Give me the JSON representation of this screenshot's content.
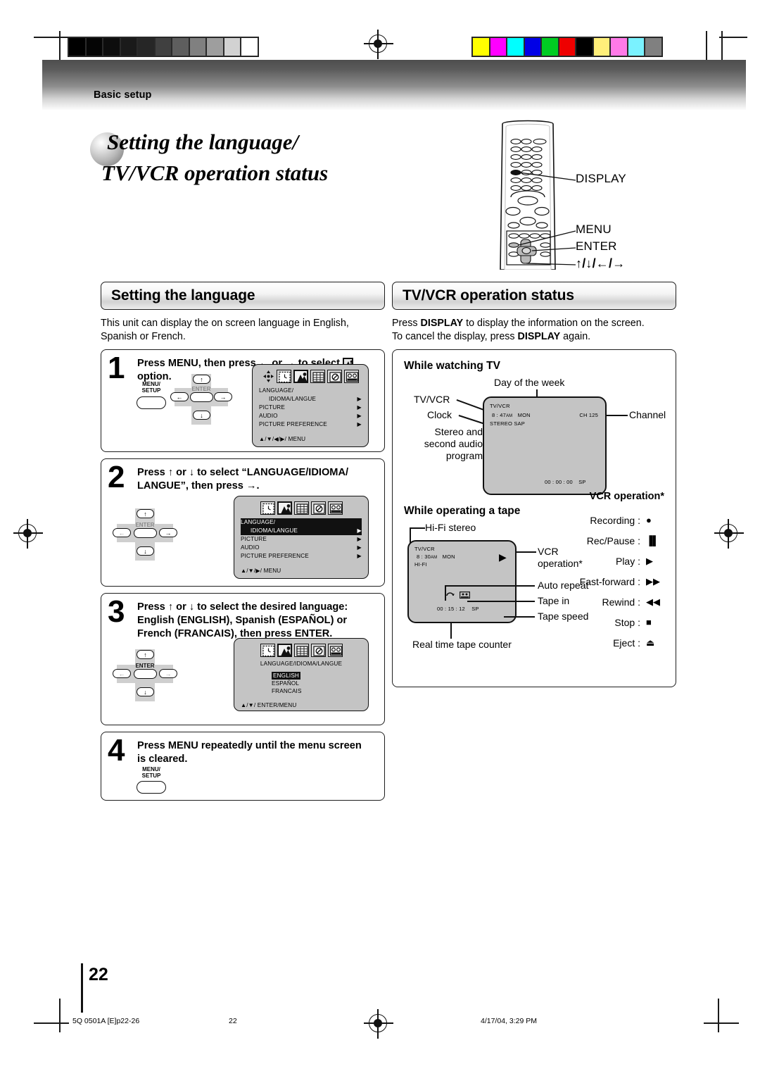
{
  "header": {
    "band_label": "Basic setup"
  },
  "title": {
    "line1": "Setting the language/",
    "line2": "TV/VCR operation status"
  },
  "remote": {
    "callouts": [
      {
        "label": "DISPLAY"
      },
      {
        "label": "MENU"
      },
      {
        "label": "ENTER"
      },
      {
        "label": "↑/↓/←/→"
      }
    ]
  },
  "left": {
    "section_title": "Setting the language",
    "intro": "This unit can display the on screen language in English, Spanish or French.",
    "steps": [
      {
        "num": "1",
        "text_html": "Press MENU, then press ← or → to select [icon] option.",
        "text_a": "Press MENU, then press",
        "text_b": "or",
        "text_c": "to select",
        "text_d": "option.",
        "pad_menu_label": "MENU/\nSETUP",
        "pad_enter_label": "ENTER"
      },
      {
        "num": "2",
        "text_a": "Press ↑ or ↓ to select “LANGUAGE/IDIOMA/",
        "text_b": "LANGUE”, then press →.",
        "pad_enter_label": "ENTER"
      },
      {
        "num": "3",
        "text_a": "Press ↑ or ↓ to select the desired language:",
        "text_b": "English (ENGLISH), Spanish (ESPAÑOL) or",
        "text_c": "French (FRANCAIS), then press ENTER.",
        "pad_enter_label": "ENTER"
      },
      {
        "num": "4",
        "text_a": "Press MENU repeatedly until the menu screen",
        "text_b": "is cleared.",
        "pad_menu_label": "MENU/\nSETUP"
      }
    ],
    "osd1": {
      "rows": [
        {
          "label_l1": "LANGUAGE/",
          "label_l2": "IDIOMA/LANGUE",
          "arrow": "▶",
          "highlight": false
        },
        {
          "label_l1": "PICTURE",
          "arrow": "▶",
          "highlight": false
        },
        {
          "label_l1": "AUDIO",
          "arrow": "▶",
          "highlight": false
        },
        {
          "label_l1": "PICTURE  PREFERENCE",
          "arrow": "▶",
          "highlight": false
        }
      ],
      "footer": "▲/▼/◀/▶/ MENU"
    },
    "osd2": {
      "rows": [
        {
          "label_l1": "LANGUAGE/",
          "label_l2": "IDIOMA/LANGUE",
          "arrow": "▶",
          "highlight": true
        },
        {
          "label_l1": "PICTURE",
          "arrow": "▶",
          "highlight": false
        },
        {
          "label_l1": "AUDIO",
          "arrow": "▶",
          "highlight": false
        },
        {
          "label_l1": "PICTURE  PREFERENCE",
          "arrow": "▶",
          "highlight": false
        }
      ],
      "footer": "▲/▼/▶/ MENU"
    },
    "osd3": {
      "heading": "LANGUAGE/IDIOMA/LANGUE",
      "options": [
        {
          "label": "ENGLISH",
          "selected": true
        },
        {
          "label": "ESPAÑOL",
          "selected": false
        },
        {
          "label": "FRANCAIS",
          "selected": false
        }
      ],
      "footer": "▲/▼/ ENTER/MENU"
    },
    "osd_icon_names": [
      "clock-icon",
      "language-person-icon",
      "grid-icon",
      "prohibited-icon",
      "vcr-tape-icon"
    ]
  },
  "right": {
    "section_title": "TV/VCR operation status",
    "intro_a": "Press ",
    "intro_b": "DISPLAY",
    "intro_c": " to display the information on the screen.",
    "intro_d": "To cancel the display, press ",
    "intro_e": "DISPLAY",
    "intro_f": " again.",
    "watching": {
      "heading": "While watching TV",
      "labels": {
        "day": "Day of the week",
        "tvvcr": "TV/VCR",
        "clock": "Clock",
        "stereo_l1": "Stereo and",
        "stereo_l2": "second audio",
        "stereo_l3": "program",
        "channel": "Channel"
      },
      "screen": {
        "tvvcr": "TV/VCR",
        "time": "8 : 47",
        "ampm": "AM",
        "day": "MON",
        "audio": "STEREO  SAP",
        "ch_label": "CH",
        "ch_num": "125",
        "counter": "00 : 00 : 00",
        "speed": "SP"
      }
    },
    "tape": {
      "heading": "While operating a tape",
      "labels": {
        "hifi": "Hi-Fi stereo",
        "vcr_op_l1": "VCR",
        "vcr_op_l2": "operation*",
        "auto_repeat": "Auto repeat",
        "tape_in": "Tape in",
        "tape_speed": "Tape speed",
        "counter": "Real time tape counter"
      },
      "screen": {
        "tvvcr": "TV/VCR",
        "time": "8 : 30",
        "ampm": "AM",
        "day": "MON",
        "hifi": "HI-FI",
        "play_glyph": "▶",
        "repeat_glyph": "↺",
        "tape_glyph": "▤",
        "counter": "00 : 15 : 12",
        "speed": "SP"
      }
    },
    "vcr_operation": {
      "title": "VCR operation*",
      "items": [
        {
          "label": "Recording :",
          "glyph": "●",
          "icon": "record-dot-icon"
        },
        {
          "label": "Rec/Pause :",
          "glyph": "▐▌",
          "icon": "pause-bars-icon"
        },
        {
          "label": "Play :",
          "glyph": "▶",
          "icon": "play-triangle-icon"
        },
        {
          "label": "Fast-forward :",
          "glyph": "▶▶",
          "icon": "fast-forward-icon"
        },
        {
          "label": "Rewind :",
          "glyph": "◀◀",
          "icon": "rewind-icon"
        },
        {
          "label": "Stop :",
          "glyph": "■",
          "icon": "stop-square-icon"
        },
        {
          "label": "Eject :",
          "glyph": "⏏",
          "icon": "eject-icon"
        }
      ]
    }
  },
  "footer": {
    "page_number": "22",
    "file_ref": "5Q 0501A [E]p22-26",
    "center_page": "22",
    "timestamp": "4/17/04, 3:29 PM"
  },
  "colorbars": {
    "grayscale": [
      "#000000",
      "#050505",
      "#0d0d0d",
      "#1a1a1a",
      "#262626",
      "#404040",
      "#5e5e5e",
      "#808080",
      "#9e9e9e",
      "#d2d2d2",
      "#ffffff"
    ],
    "color": [
      "#ffff00",
      "#ff00ff",
      "#00ffff",
      "#0000e6",
      "#00cc22",
      "#ee0000",
      "#000000",
      "#ffef7a",
      "#ff7ae8",
      "#7af2ff",
      "#808080"
    ]
  }
}
